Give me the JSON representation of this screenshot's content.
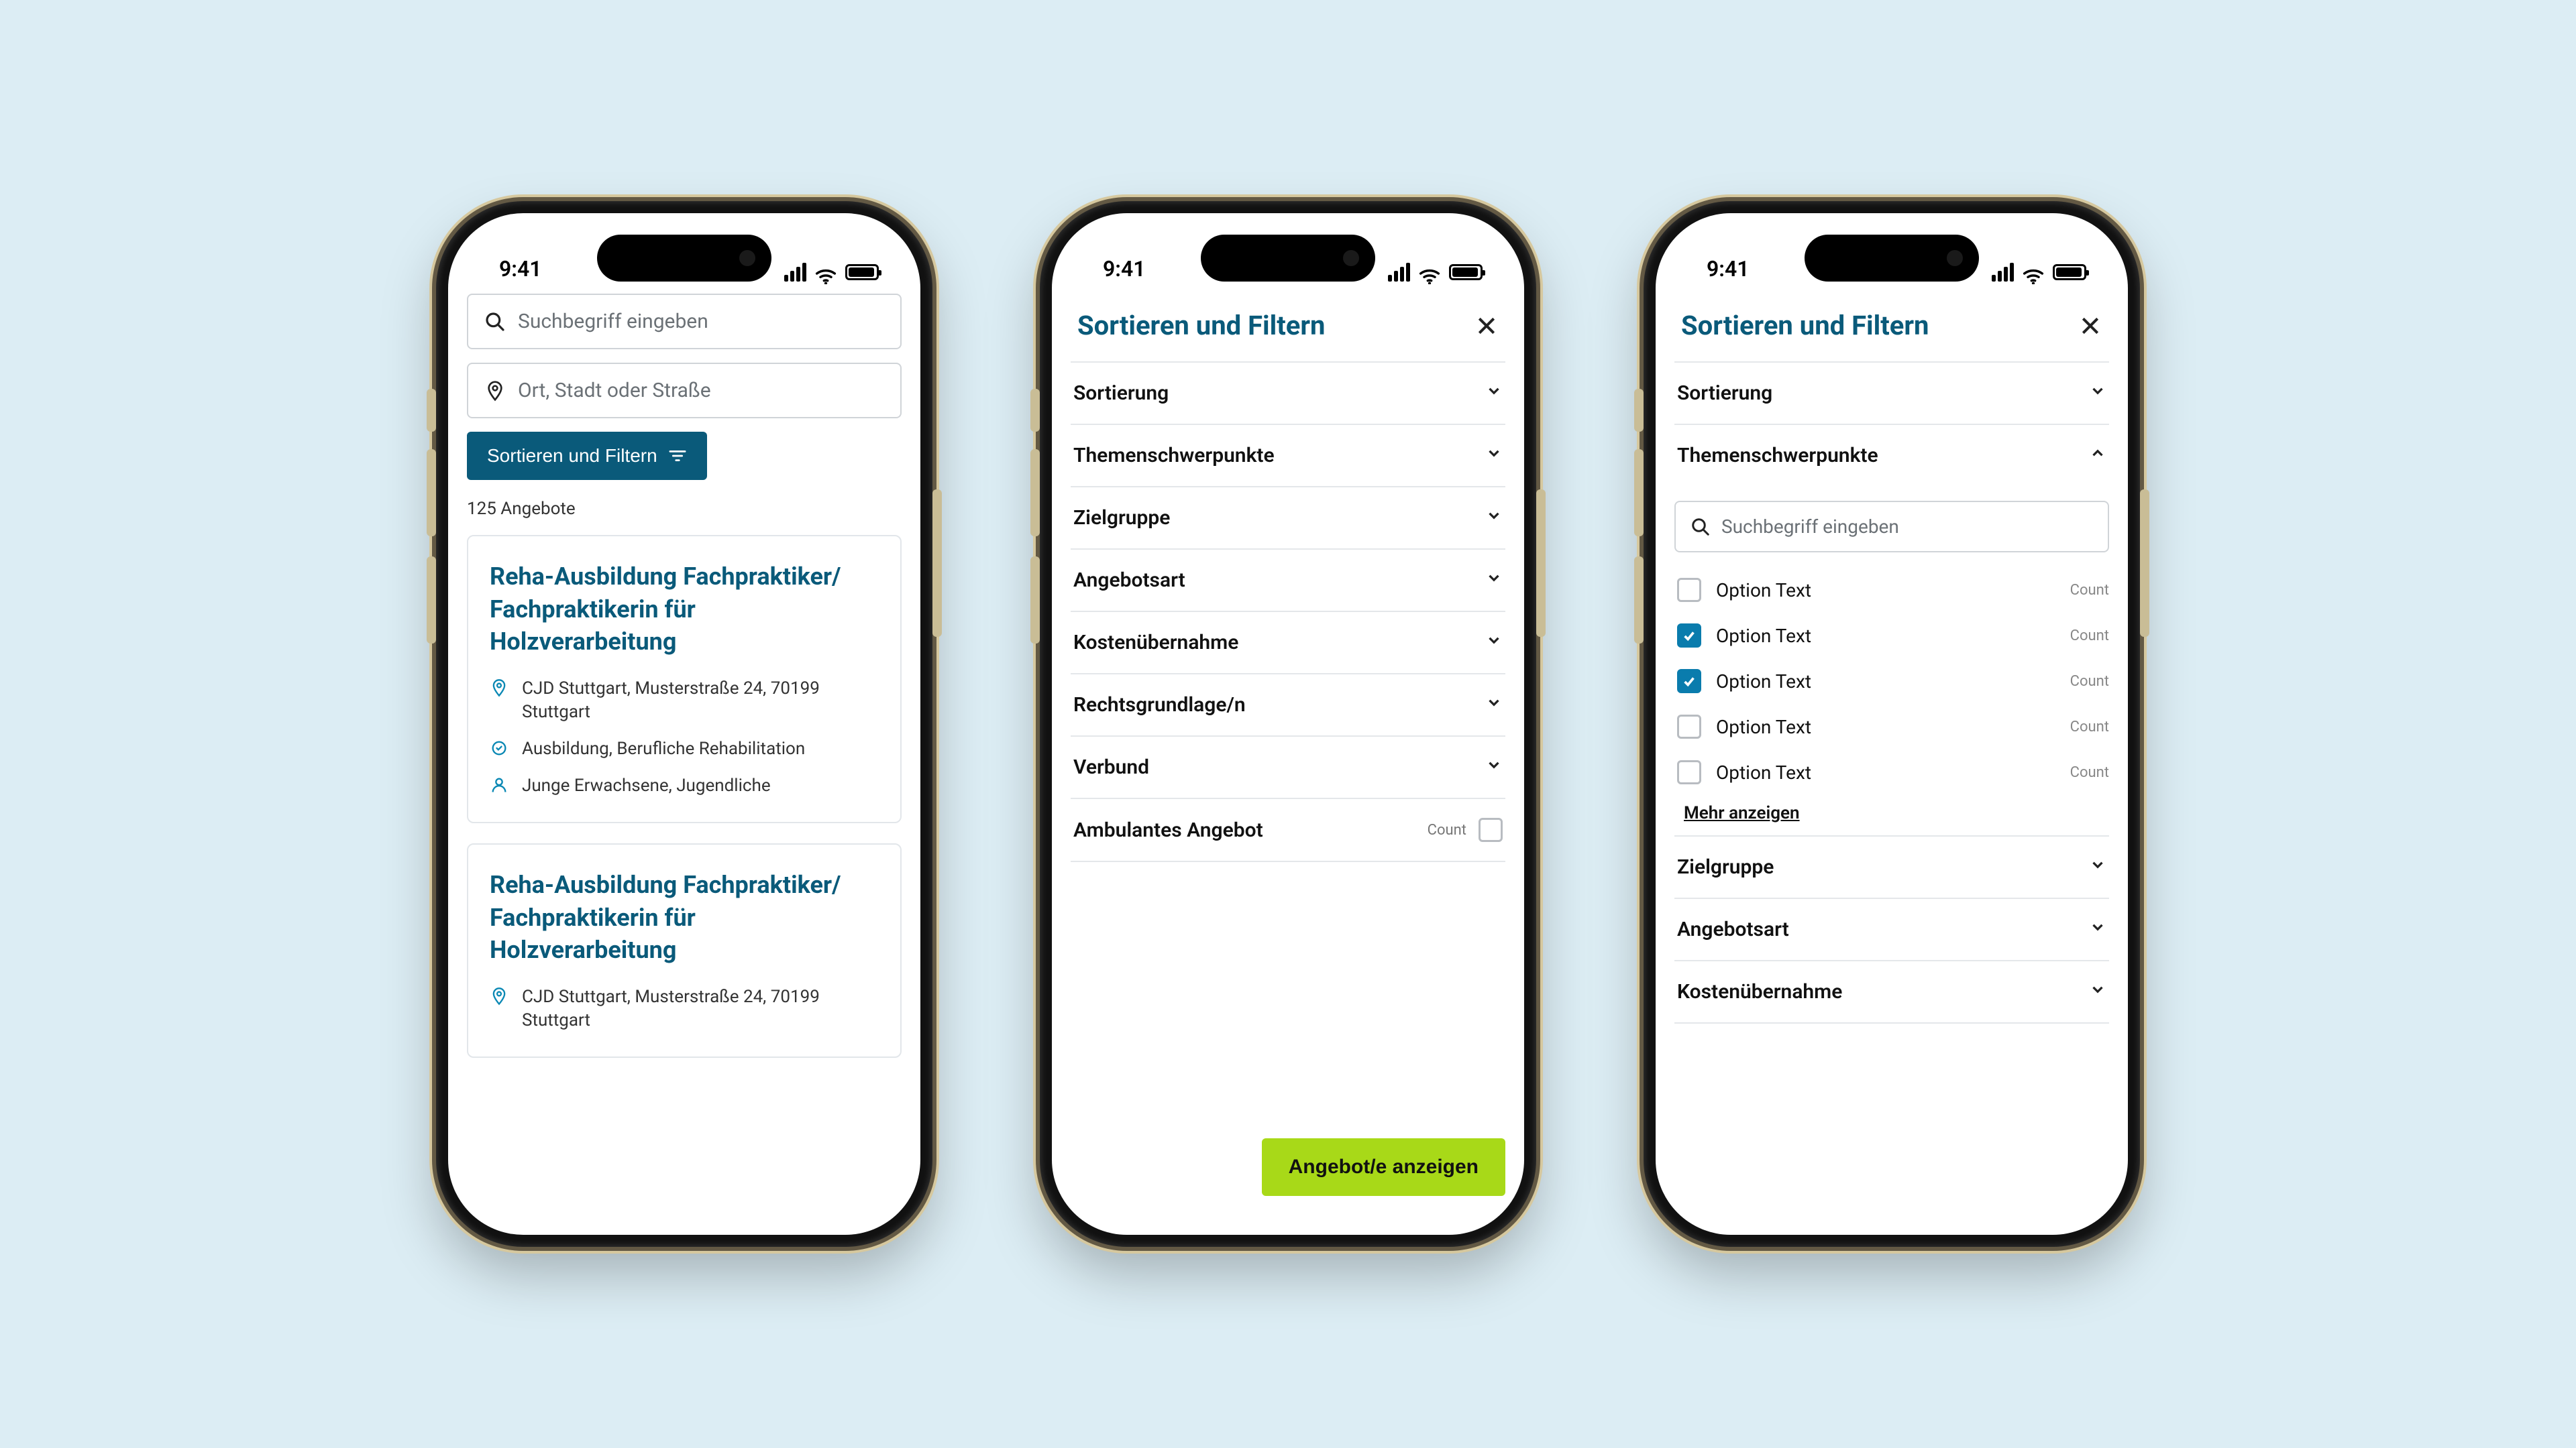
{
  "statusbar": {
    "time": "9:41"
  },
  "screen1": {
    "search_placeholder": "Suchbegriff eingeben",
    "location_placeholder": "Ort, Stadt oder Straße",
    "filter_button": "Sortieren und Filtern",
    "result_count": "125 Angebote",
    "cards": [
      {
        "title": "Reha-Ausbildung Fachpraktiker/ Fachpraktikerin für Holzverarbeitung",
        "location": "CJD Stuttgart, Musterstraße 24, 70199 Stuttgart",
        "type": "Ausbildung, Berufliche Rehabilitation",
        "audience": "Junge Erwachsene, Jugendliche"
      },
      {
        "title": "Reha-Ausbildung Fachpraktiker/ Fachpraktikerin für Holzverarbeitung",
        "location": "CJD Stuttgart, Musterstraße 24, 70199 Stuttgart"
      }
    ]
  },
  "screen2": {
    "panel_title": "Sortieren und Filtern",
    "rows": [
      "Sortierung",
      "Themenschwerpunkte",
      "Zielgruppe",
      "Angebotsart",
      "Kostenübernahme",
      "Rechtsgrundlage/n",
      "Verbund"
    ],
    "switch_label": "Ambulantes Angebot",
    "switch_count": "Count",
    "apply_button": "Angebot/e anzeigen"
  },
  "screen3": {
    "panel_title": "Sortieren und Filtern",
    "top_rows": [
      "Sortierung"
    ],
    "expanded_label": "Themenschwerpunkte",
    "search_placeholder": "Suchbegriff eingeben",
    "options": [
      {
        "label": "Option Text",
        "count": "Count",
        "checked": false
      },
      {
        "label": "Option Text",
        "count": "Count",
        "checked": true
      },
      {
        "label": "Option Text",
        "count": "Count",
        "checked": true
      },
      {
        "label": "Option Text",
        "count": "Count",
        "checked": false
      },
      {
        "label": "Option Text",
        "count": "Count",
        "checked": false
      }
    ],
    "more_label": "Mehr anzeigen",
    "bottom_rows": [
      "Zielgruppe",
      "Angebotsart",
      "Kostenübernahme"
    ]
  }
}
